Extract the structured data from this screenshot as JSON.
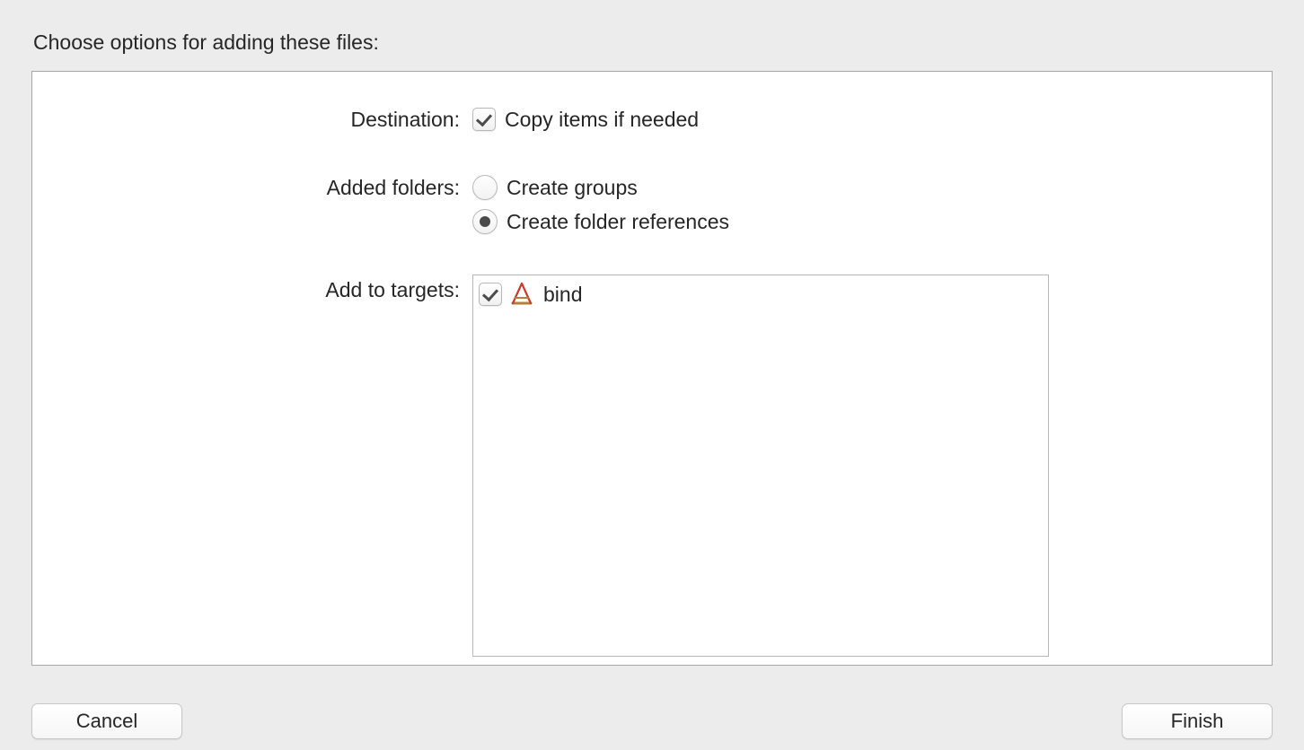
{
  "title": "Choose options for adding these files:",
  "destination": {
    "label": "Destination:",
    "copy_items": {
      "label": "Copy items if needed",
      "checked": true
    }
  },
  "added_folders": {
    "label": "Added folders:",
    "options": [
      {
        "label": "Create groups",
        "selected": false
      },
      {
        "label": "Create folder references",
        "selected": true
      }
    ]
  },
  "add_to_targets": {
    "label": "Add to targets:",
    "targets": [
      {
        "name": "bind",
        "checked": true,
        "icon": "app-icon"
      }
    ]
  },
  "buttons": {
    "cancel": "Cancel",
    "finish": "Finish"
  }
}
